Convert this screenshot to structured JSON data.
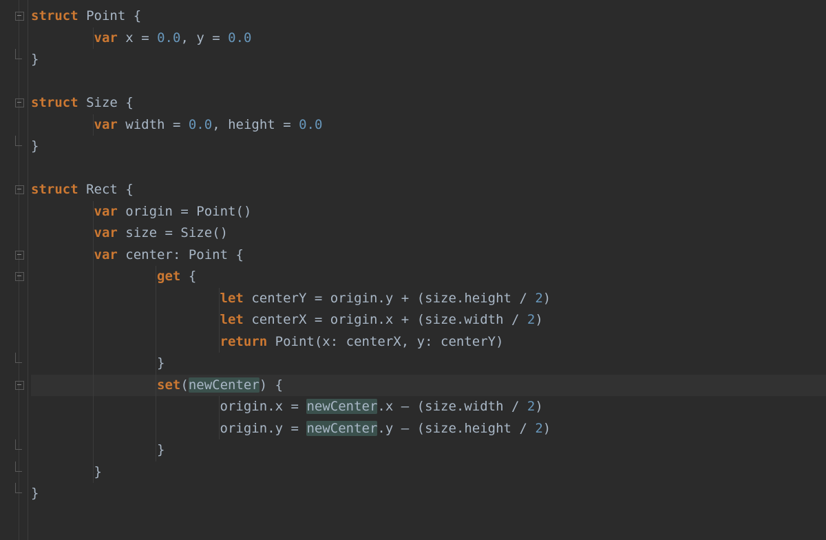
{
  "colors": {
    "background": "#2b2b2b",
    "keyword": "#cc7832",
    "number": "#6897bb",
    "text": "#a9b7c6",
    "highlight_line": "#323232",
    "highlight_word": "#3b514d"
  },
  "highlighted_line_index": 17,
  "highlighted_identifier": "newCenter",
  "lines": [
    {
      "indent": 0,
      "gutter": "fold-open",
      "tokens": [
        [
          "kw",
          "struct"
        ],
        [
          "sp",
          " "
        ],
        [
          "type",
          "Point"
        ],
        [
          "sp",
          " "
        ],
        [
          "punc",
          "{"
        ]
      ]
    },
    {
      "indent": 1,
      "gutter": "line",
      "tokens": [
        [
          "kw",
          "var"
        ],
        [
          "sp",
          " "
        ],
        [
          "ident",
          "x"
        ],
        [
          "sp",
          " "
        ],
        [
          "op",
          "="
        ],
        [
          "sp",
          " "
        ],
        [
          "num",
          "0.0"
        ],
        [
          "punc",
          ","
        ],
        [
          "sp",
          " "
        ],
        [
          "ident",
          "y"
        ],
        [
          "sp",
          " "
        ],
        [
          "op",
          "="
        ],
        [
          "sp",
          " "
        ],
        [
          "num",
          "0.0"
        ]
      ]
    },
    {
      "indent": 0,
      "gutter": "fold-end",
      "tokens": [
        [
          "punc",
          "}"
        ]
      ]
    },
    {
      "indent": 0,
      "gutter": "blank",
      "tokens": []
    },
    {
      "indent": 0,
      "gutter": "fold-open",
      "tokens": [
        [
          "kw",
          "struct"
        ],
        [
          "sp",
          " "
        ],
        [
          "type",
          "Size"
        ],
        [
          "sp",
          " "
        ],
        [
          "punc",
          "{"
        ]
      ]
    },
    {
      "indent": 1,
      "gutter": "line",
      "tokens": [
        [
          "kw",
          "var"
        ],
        [
          "sp",
          " "
        ],
        [
          "ident",
          "width"
        ],
        [
          "sp",
          " "
        ],
        [
          "op",
          "="
        ],
        [
          "sp",
          " "
        ],
        [
          "num",
          "0.0"
        ],
        [
          "punc",
          ","
        ],
        [
          "sp",
          " "
        ],
        [
          "ident",
          "height"
        ],
        [
          "sp",
          " "
        ],
        [
          "op",
          "="
        ],
        [
          "sp",
          " "
        ],
        [
          "num",
          "0.0"
        ]
      ]
    },
    {
      "indent": 0,
      "gutter": "fold-end",
      "tokens": [
        [
          "punc",
          "}"
        ]
      ]
    },
    {
      "indent": 0,
      "gutter": "blank",
      "tokens": []
    },
    {
      "indent": 0,
      "gutter": "fold-open",
      "tokens": [
        [
          "kw",
          "struct"
        ],
        [
          "sp",
          " "
        ],
        [
          "type",
          "Rect"
        ],
        [
          "sp",
          " "
        ],
        [
          "punc",
          "{"
        ]
      ]
    },
    {
      "indent": 1,
      "gutter": "line",
      "tokens": [
        [
          "kw",
          "var"
        ],
        [
          "sp",
          " "
        ],
        [
          "ident",
          "origin"
        ],
        [
          "sp",
          " "
        ],
        [
          "op",
          "="
        ],
        [
          "sp",
          " "
        ],
        [
          "type",
          "Point"
        ],
        [
          "punc",
          "()"
        ]
      ]
    },
    {
      "indent": 1,
      "gutter": "line",
      "tokens": [
        [
          "kw",
          "var"
        ],
        [
          "sp",
          " "
        ],
        [
          "ident",
          "size"
        ],
        [
          "sp",
          " "
        ],
        [
          "op",
          "="
        ],
        [
          "sp",
          " "
        ],
        [
          "type",
          "Size"
        ],
        [
          "punc",
          "()"
        ]
      ]
    },
    {
      "indent": 1,
      "gutter": "fold-open",
      "tokens": [
        [
          "kw",
          "var"
        ],
        [
          "sp",
          " "
        ],
        [
          "ident",
          "center"
        ],
        [
          "punc",
          ":"
        ],
        [
          "sp",
          " "
        ],
        [
          "type",
          "Point"
        ],
        [
          "sp",
          " "
        ],
        [
          "punc",
          "{"
        ]
      ]
    },
    {
      "indent": 2,
      "gutter": "fold-open",
      "tokens": [
        [
          "kw",
          "get"
        ],
        [
          "sp",
          " "
        ],
        [
          "punc",
          "{"
        ]
      ]
    },
    {
      "indent": 3,
      "gutter": "line",
      "tokens": [
        [
          "kw",
          "let"
        ],
        [
          "sp",
          " "
        ],
        [
          "ident",
          "centerY"
        ],
        [
          "sp",
          " "
        ],
        [
          "op",
          "="
        ],
        [
          "sp",
          " "
        ],
        [
          "ident",
          "origin"
        ],
        [
          "punc",
          "."
        ],
        [
          "ident",
          "y"
        ],
        [
          "sp",
          " "
        ],
        [
          "op",
          "+"
        ],
        [
          "sp",
          " "
        ],
        [
          "punc",
          "("
        ],
        [
          "ident",
          "size"
        ],
        [
          "punc",
          "."
        ],
        [
          "ident",
          "height"
        ],
        [
          "sp",
          " "
        ],
        [
          "op",
          "/"
        ],
        [
          "sp",
          " "
        ],
        [
          "num",
          "2"
        ],
        [
          "punc",
          ")"
        ]
      ]
    },
    {
      "indent": 3,
      "gutter": "line",
      "tokens": [
        [
          "kw",
          "let"
        ],
        [
          "sp",
          " "
        ],
        [
          "ident",
          "centerX"
        ],
        [
          "sp",
          " "
        ],
        [
          "op",
          "="
        ],
        [
          "sp",
          " "
        ],
        [
          "ident",
          "origin"
        ],
        [
          "punc",
          "."
        ],
        [
          "ident",
          "x"
        ],
        [
          "sp",
          " "
        ],
        [
          "op",
          "+"
        ],
        [
          "sp",
          " "
        ],
        [
          "punc",
          "("
        ],
        [
          "ident",
          "size"
        ],
        [
          "punc",
          "."
        ],
        [
          "ident",
          "width"
        ],
        [
          "sp",
          " "
        ],
        [
          "op",
          "/"
        ],
        [
          "sp",
          " "
        ],
        [
          "num",
          "2"
        ],
        [
          "punc",
          ")"
        ]
      ]
    },
    {
      "indent": 3,
      "gutter": "line",
      "tokens": [
        [
          "kw",
          "return"
        ],
        [
          "sp",
          " "
        ],
        [
          "type",
          "Point"
        ],
        [
          "punc",
          "("
        ],
        [
          "ident",
          "x"
        ],
        [
          "punc",
          ":"
        ],
        [
          "sp",
          " "
        ],
        [
          "ident",
          "centerX"
        ],
        [
          "punc",
          ","
        ],
        [
          "sp",
          " "
        ],
        [
          "ident",
          "y"
        ],
        [
          "punc",
          ":"
        ],
        [
          "sp",
          " "
        ],
        [
          "ident",
          "centerY"
        ],
        [
          "punc",
          ")"
        ]
      ]
    },
    {
      "indent": 2,
      "gutter": "fold-end",
      "tokens": [
        [
          "punc",
          "}"
        ]
      ]
    },
    {
      "indent": 2,
      "gutter": "fold-open",
      "hl": true,
      "tokens": [
        [
          "kw",
          "set"
        ],
        [
          "punc",
          "("
        ],
        [
          "hlword",
          "newCenter"
        ],
        [
          "punc",
          ")"
        ],
        [
          "sp",
          " "
        ],
        [
          "punc",
          "{"
        ]
      ]
    },
    {
      "indent": 3,
      "gutter": "line",
      "tokens": [
        [
          "ident",
          "origin"
        ],
        [
          "punc",
          "."
        ],
        [
          "ident",
          "x"
        ],
        [
          "sp",
          " "
        ],
        [
          "op",
          "="
        ],
        [
          "sp",
          " "
        ],
        [
          "hlword",
          "newCenter"
        ],
        [
          "punc",
          "."
        ],
        [
          "ident",
          "x"
        ],
        [
          "sp",
          " "
        ],
        [
          "op",
          "–"
        ],
        [
          "sp",
          " "
        ],
        [
          "punc",
          "("
        ],
        [
          "ident",
          "size"
        ],
        [
          "punc",
          "."
        ],
        [
          "ident",
          "width"
        ],
        [
          "sp",
          " "
        ],
        [
          "op",
          "/"
        ],
        [
          "sp",
          " "
        ],
        [
          "num",
          "2"
        ],
        [
          "punc",
          ")"
        ]
      ]
    },
    {
      "indent": 3,
      "gutter": "line",
      "tokens": [
        [
          "ident",
          "origin"
        ],
        [
          "punc",
          "."
        ],
        [
          "ident",
          "y"
        ],
        [
          "sp",
          " "
        ],
        [
          "op",
          "="
        ],
        [
          "sp",
          " "
        ],
        [
          "hlword",
          "newCenter"
        ],
        [
          "punc",
          "."
        ],
        [
          "ident",
          "y"
        ],
        [
          "sp",
          " "
        ],
        [
          "op",
          "–"
        ],
        [
          "sp",
          " "
        ],
        [
          "punc",
          "("
        ],
        [
          "ident",
          "size"
        ],
        [
          "punc",
          "."
        ],
        [
          "ident",
          "height"
        ],
        [
          "sp",
          " "
        ],
        [
          "op",
          "/"
        ],
        [
          "sp",
          " "
        ],
        [
          "num",
          "2"
        ],
        [
          "punc",
          ")"
        ]
      ]
    },
    {
      "indent": 2,
      "gutter": "fold-end",
      "tokens": [
        [
          "punc",
          "}"
        ]
      ]
    },
    {
      "indent": 1,
      "gutter": "fold-end",
      "tokens": [
        [
          "punc",
          "}"
        ]
      ]
    },
    {
      "indent": 0,
      "gutter": "fold-end",
      "tokens": [
        [
          "punc",
          "}"
        ]
      ]
    }
  ]
}
